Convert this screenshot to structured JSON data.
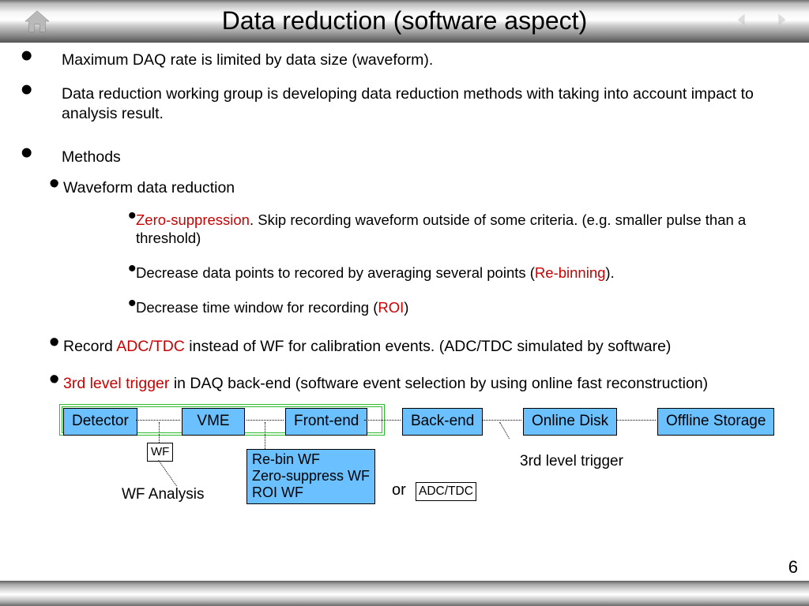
{
  "header": {
    "title": "Data reduction (software aspect)"
  },
  "bullets": {
    "b1": "Maximum DAQ rate is limited by data size (waveform).",
    "b2": "Data reduction working group is developing data reduction methods with taking into account impact to analysis result.",
    "b3": "Methods",
    "b3a": "Waveform data reduction",
    "b3a1_red": "Zero-suppression",
    "b3a1_rest": ". Skip recording waveform outside of some criteria. (e.g. smaller pulse than a threshold)",
    "b3a2_pre": "Decrease data points to recored by averaging several points (",
    "b3a2_red": "Re-binning",
    "b3a2_post": ").",
    "b3a3_pre": "Decrease time window for recording (",
    "b3a3_red": "ROI",
    "b3a3_post": ")",
    "b3b_pre": "Record ",
    "b3b_red": "ADC/TDC",
    "b3b_post": " instead of WF for calibration events. (ADC/TDC simulated by software)",
    "b3c_red": "3rd level trigger",
    "b3c_post": " in DAQ back-end (software event selection by using online fast reconstruction)"
  },
  "diagram": {
    "detector": "Detector",
    "vme": "VME",
    "frontend": "Front-end",
    "backend": "Back-end",
    "onlinedisk": "Online Disk",
    "offlinestorage": "Offline Storage",
    "wf": "WF",
    "wfanalysis": "WF Analysis",
    "rebin": "Re-bin WF\nZero-suppress WF\nROI WF",
    "or": "or",
    "adctdc": "ADC/TDC",
    "trigger": "3rd level trigger"
  },
  "page": "6"
}
